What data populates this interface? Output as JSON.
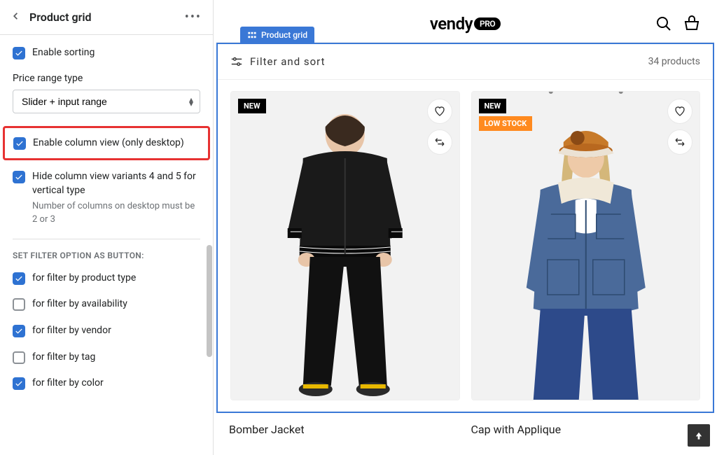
{
  "sidebar": {
    "title": "Product grid",
    "enable_sorting": {
      "label": "Enable sorting",
      "checked": true
    },
    "price_range_label": "Price range type",
    "price_range_value": "Slider + input range",
    "enable_column_view": {
      "label": "Enable column view (only desktop)",
      "checked": true
    },
    "hide_column_variants": {
      "label": "Hide column view variants 4 and 5 for vertical type",
      "sub": "Number of columns on desktop must be 2 or 3",
      "checked": true
    },
    "section_heading": "SET FILTER OPTION AS BUTTON:",
    "filter_options": [
      {
        "label": "for filter by product type",
        "checked": true
      },
      {
        "label": "for filter by availability",
        "checked": false
      },
      {
        "label": "for filter by vendor",
        "checked": true
      },
      {
        "label": "for filter by tag",
        "checked": false
      },
      {
        "label": "for filter by color",
        "checked": true
      }
    ]
  },
  "preview": {
    "block_tag": "Product grid",
    "logo_main": "vendy",
    "logo_badge": "PRO",
    "filter_label": "Filter and sort",
    "product_count": "34 products",
    "products": [
      {
        "title": "Bomber Jacket",
        "badges": [
          "NEW"
        ]
      },
      {
        "title": "Cap with Applique",
        "badges": [
          "NEW",
          "LOW STOCK"
        ]
      }
    ]
  }
}
